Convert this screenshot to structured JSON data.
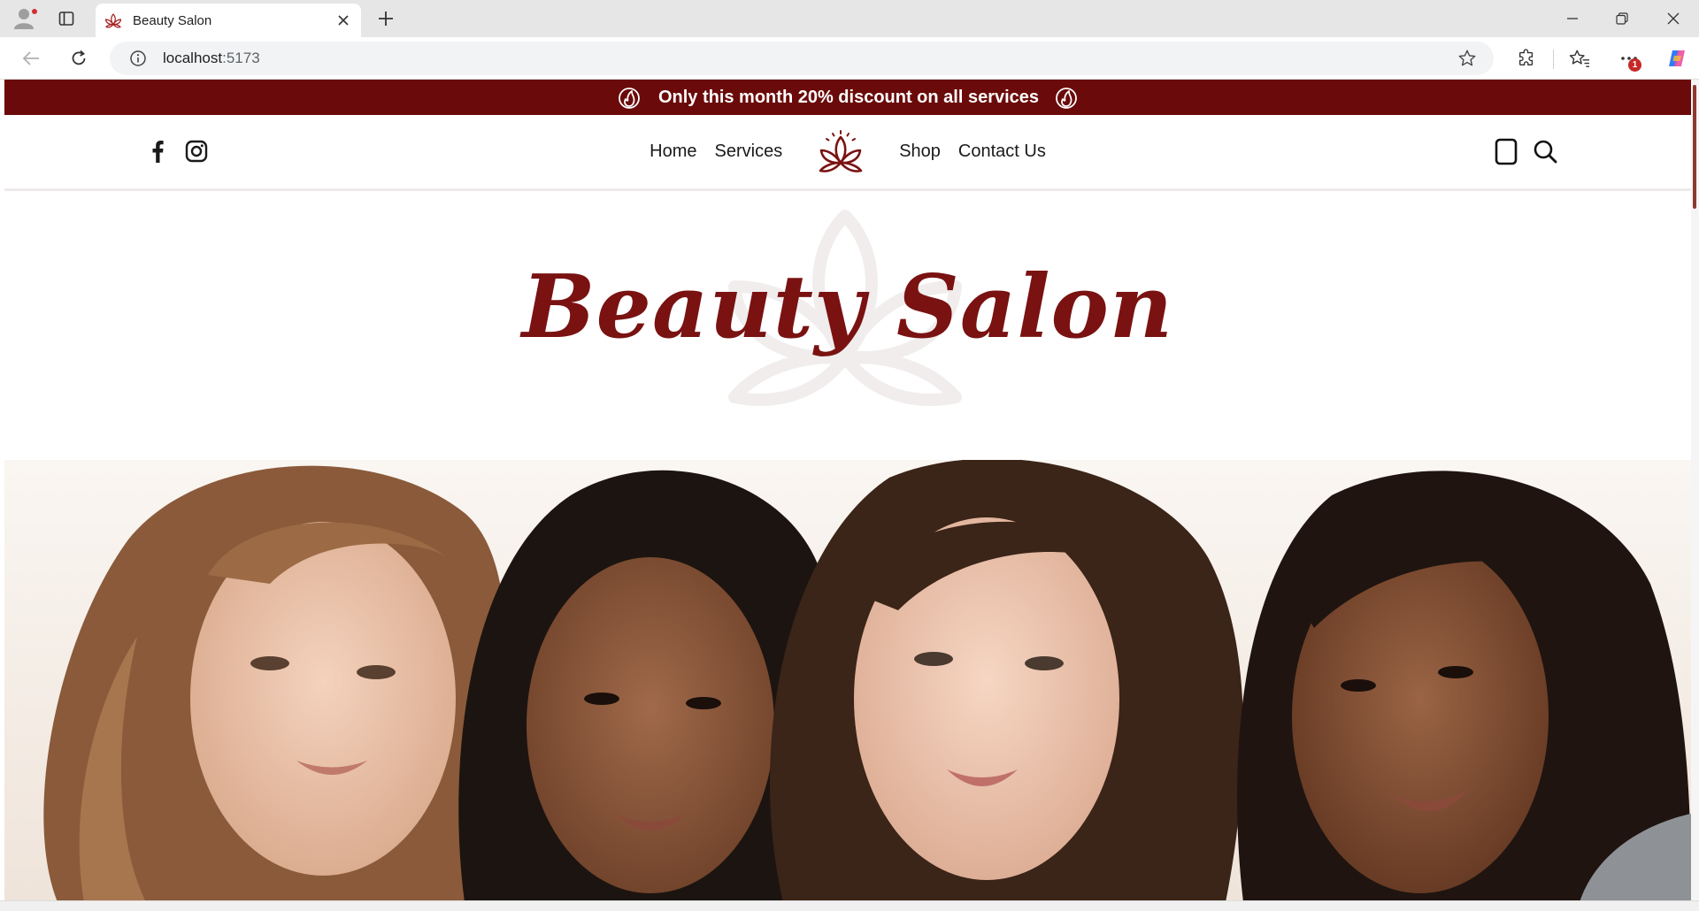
{
  "browser": {
    "tab_title": "Beauty Salon",
    "url_host": "localhost",
    "url_port": ":5173",
    "notification_count": "1"
  },
  "promo": {
    "text": "Only this month 20% discount on all services",
    "icon": "fire-icon"
  },
  "header": {
    "social": [
      "facebook-icon",
      "instagram-icon"
    ],
    "nav": {
      "home": "Home",
      "services": "Services",
      "shop": "Shop",
      "contact": "Contact Us"
    },
    "logo_icon": "lotus-icon",
    "actions": [
      "bag-icon",
      "search-icon"
    ]
  },
  "hero": {
    "title": "Beauty Salon",
    "watermark_icon": "lotus-icon",
    "image_subjects": "four-women-portrait"
  },
  "colors": {
    "brand": "#6b0a0a",
    "title": "#7a1212",
    "text": "#1a1a1a",
    "background": "#ffffff"
  }
}
